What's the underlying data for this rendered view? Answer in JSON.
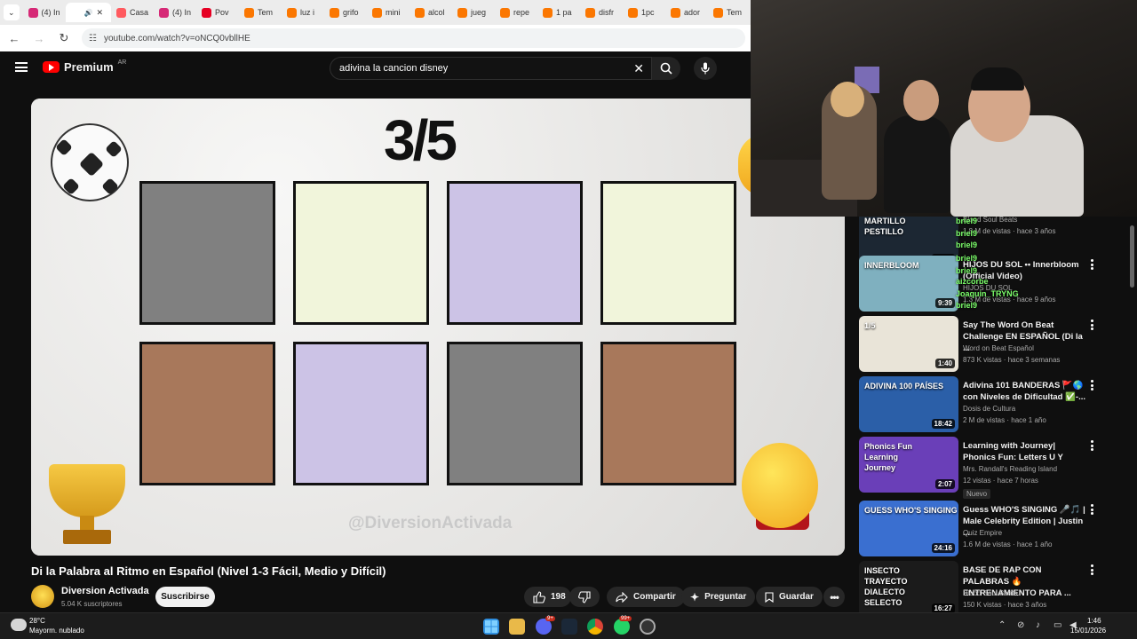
{
  "browser": {
    "tabs": [
      {
        "label": "(4) In",
        "color": "#d62976"
      },
      {
        "label": "",
        "color": "#ffffff",
        "active": true
      },
      {
        "label": "Casa",
        "color": "#ff5a5f"
      },
      {
        "label": "(4) In",
        "color": "#d62976"
      },
      {
        "label": "Pov",
        "color": "#e60023"
      },
      {
        "label": "Tem",
        "color": "#fb7701"
      },
      {
        "label": "luz i",
        "color": "#fb7701"
      },
      {
        "label": "grifo",
        "color": "#fb7701"
      },
      {
        "label": "mini",
        "color": "#fb7701"
      },
      {
        "label": "alcol",
        "color": "#fb7701"
      },
      {
        "label": "jueg",
        "color": "#fb7701"
      },
      {
        "label": "repe",
        "color": "#fb7701"
      },
      {
        "label": "1 pa",
        "color": "#fb7701"
      },
      {
        "label": "disfr",
        "color": "#fb7701"
      },
      {
        "label": "1pc",
        "color": "#fb7701"
      },
      {
        "label": "ador",
        "color": "#fb7701"
      },
      {
        "label": "Tem",
        "color": "#fb7701"
      }
    ],
    "url": "youtube.com/watch?v=oNCQ0vbllHE"
  },
  "youtube": {
    "logo_text": "Premium",
    "country_code": "AR",
    "search_query": "adivina la cancion disney"
  },
  "video": {
    "score_text": "3/5",
    "watermark": "@DiversionActivada",
    "cards_row1": [
      "#808080",
      "#f1f5db",
      "#ccc3e6",
      "#f1f5db"
    ],
    "cards_row2": [
      "#a8785b",
      "#ccc3e6",
      "#808080",
      "#a8785b"
    ],
    "title": "Di la Palabra al Ritmo en Español (Nivel 1-3 Fácil, Medio y Difícil)",
    "channel_name": "Diversion Activada",
    "channel_subs": "5.04 K suscriptores",
    "subscribe_label": "Suscribirse",
    "like_count": "198",
    "share_label": "Compartir",
    "ask_label": "Preguntar",
    "save_label": "Guardar"
  },
  "chat_overlay": [
    "briel9",
    "briel9",
    "briel9",
    "briel9",
    "briel9",
    "aizcorbe",
    "Joaquin_TRYNG",
    "briel9"
  ],
  "recommendations": [
    {
      "title": "",
      "channel": "Blood Soul Beats",
      "meta": "1.8 M de vistas · hace 3 años",
      "duration": "16:46",
      "thumb": [
        "MARTILLO",
        "PESTILLO"
      ],
      "thumb_color": "#1c2733"
    },
    {
      "title": "HIJOS DU SOL •• Innerbloom (Official Video)",
      "channel": "HIJOS DU SOL",
      "meta": "1.3 M de vistas · hace 9 años",
      "duration": "9:39",
      "thumb": [
        "INNERBLOOM"
      ],
      "thumb_color": "#7fb0bf"
    },
    {
      "title": "Say The Word On Beat Challenge EN ESPAÑOL (Di la ...",
      "channel": "Word on Beat Español",
      "meta": "873 K vistas · hace 3 semanas",
      "duration": "1:40",
      "thumb": [
        "1/5"
      ],
      "thumb_color": "#e9e4d8"
    },
    {
      "title": "Adivina 101 BANDERAS 🚩🌎 con Niveles de Dificultad ✅-...",
      "channel": "Dosis de Cultura",
      "meta": "2 M de vistas · hace 1 año",
      "duration": "18:42",
      "thumb": [
        "ADIVINA 100 PAÍSES"
      ],
      "thumb_color": "#2b5fa8"
    },
    {
      "title": "Learning with Journey| Phonics Fun: Letters U Y",
      "channel": "Mrs. Randall's Reading Island",
      "meta": "12 vistas · hace 7 horas",
      "duration": "2:07",
      "badge": "Nuevo",
      "thumb": [
        "Phonics Fun",
        "Learning",
        "Journey"
      ],
      "thumb_color": "#6a3fb8"
    },
    {
      "title": "Guess WHO'S SINGING 🎤🎵 | Male Celebrity Edition | Justin ...",
      "channel": "Quiz Empire",
      "meta": "1.6 M de vistas · hace 1 año",
      "duration": "24:16",
      "thumb": [
        "GUESS WHO'S SINGING"
      ],
      "thumb_color": "#3a6fd0"
    },
    {
      "title": "BASE DE RAP CON PALABRAS 🔥 ENTRENAMIENTO PARA ...",
      "channel": "Blood Soul Beats",
      "meta": "150 K vistas · hace 3 años",
      "duration": "16:27",
      "thumb": [
        "INSECTO",
        "TRAYECTO",
        "DIALECTO",
        "SELECTO"
      ],
      "thumb_color": "#1b1b1b"
    }
  ],
  "taskbar": {
    "temp": "28°C",
    "weather": "Mayorm. nublado",
    "time": "1:46",
    "date": "15/01/2026",
    "badge_discord": "9+",
    "badge_whatsapp": "99+"
  }
}
